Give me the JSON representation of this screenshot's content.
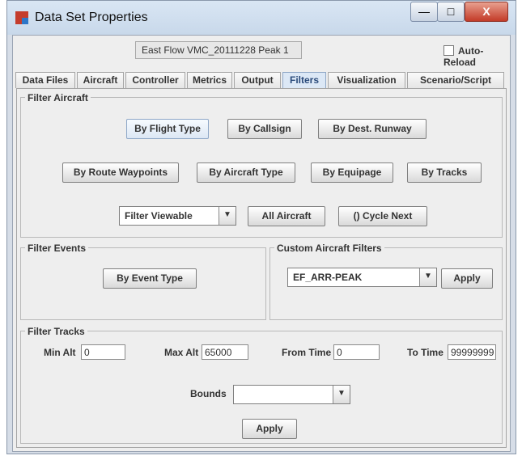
{
  "window": {
    "title": "Data Set Properties",
    "controls": {
      "minimize": "—",
      "maximize": "□",
      "close": "X"
    }
  },
  "header": {
    "dataset_name": "East Flow VMC_20111228 Peak 1",
    "auto_reload_label": "Auto-Reload",
    "auto_reload_checked": false
  },
  "tabs": [
    {
      "label": "Data Files"
    },
    {
      "label": "Aircraft"
    },
    {
      "label": "Controller"
    },
    {
      "label": "Metrics"
    },
    {
      "label": "Output"
    },
    {
      "label": "Filters",
      "active": true
    },
    {
      "label": "Visualization"
    },
    {
      "label": "Scenario/Script"
    }
  ],
  "filter_aircraft": {
    "legend": "Filter Aircraft",
    "buttons": {
      "by_flight_type": "By Flight Type",
      "by_callsign": "By Callsign",
      "by_dest_runway": "By Dest. Runway",
      "by_route_waypoints": "By Route Waypoints",
      "by_aircraft_type": "By Aircraft Type",
      "by_equipage": "By Equipage",
      "by_tracks": "By Tracks",
      "all_aircraft": "All Aircraft",
      "cycle_next": "() Cycle Next"
    },
    "viewable_select": {
      "selected": "Filter Viewable"
    }
  },
  "filter_events": {
    "legend": "Filter Events",
    "by_event_type": "By Event Type"
  },
  "custom_filters": {
    "legend": "Custom Aircraft Filters",
    "selected": "EF_ARR-PEAK",
    "apply": "Apply"
  },
  "filter_tracks": {
    "legend": "Filter Tracks",
    "min_alt_label": "Min Alt",
    "min_alt_value": "0",
    "max_alt_label": "Max Alt",
    "max_alt_value": "65000",
    "from_time_label": "From Time",
    "from_time_value": "0",
    "to_time_label": "To Time",
    "to_time_value": "99999999",
    "bounds_label": "Bounds",
    "bounds_value": "",
    "apply": "Apply"
  },
  "colors": {
    "active_tab": "#dce8f6",
    "close_button": "#c33b28",
    "panel_background": "#eeeeee"
  }
}
